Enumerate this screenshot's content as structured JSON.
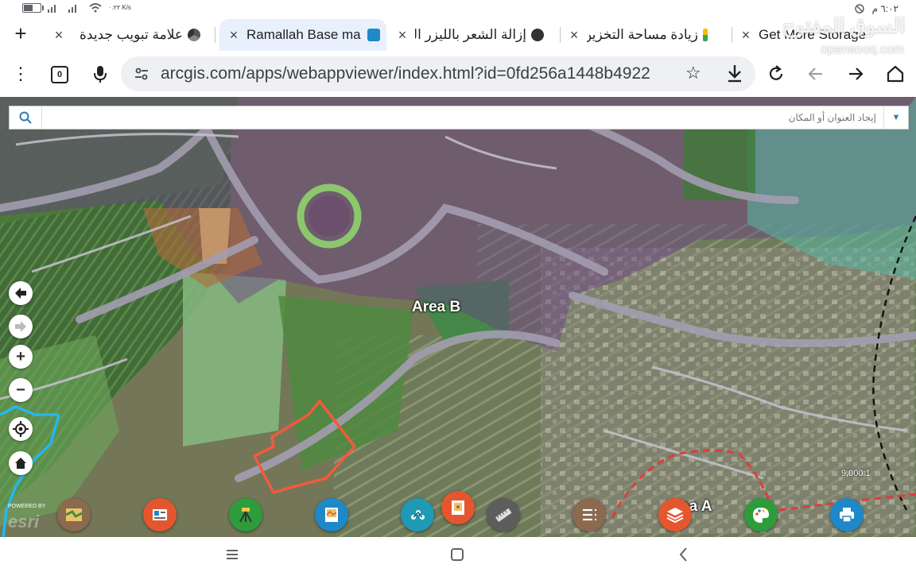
{
  "status_bar": {
    "time": "٦:٠٢ م",
    "net_speed": "٠.٢٢ K/s",
    "battery_level": 0.6
  },
  "tabs": [
    {
      "title": "علامة تبويب جديدة",
      "favicon": "chrome-icon",
      "active": false
    },
    {
      "title": "Ramallah Base ma",
      "favicon": "arcgis-icon",
      "active": true
    },
    {
      "title": "إزالة الشعر بالليزر الدو",
      "favicon": "globe-icon",
      "active": false
    },
    {
      "title": "زيادة مساحة التخزين",
      "favicon": "google-icon",
      "active": false
    },
    {
      "title": "Get More Storage",
      "favicon": "google-icon",
      "active": false
    }
  ],
  "toolbar": {
    "tab_count": "0",
    "url": "arcgis.com/apps/webappviewer/index.html?id=0fd256a1448b4922"
  },
  "map": {
    "search_placeholder": "إيجاد العنوان أو المكان",
    "labels": {
      "area_b": "Area B",
      "area_a": "ea A"
    },
    "scale_text": "9,000:1",
    "powered_by": "POWERED BY",
    "esri_logo": "esri",
    "widgets": [
      {
        "name": "basemap-gallery-widget",
        "color": "#8b6a4f"
      },
      {
        "name": "coordinate-widget",
        "color": "#e4572e"
      },
      {
        "name": "measurement-survey-widget",
        "color": "#2e9c3b"
      },
      {
        "name": "map-document-widget",
        "color": "#1e88c8"
      },
      {
        "name": "analysis-widget",
        "color": "#1e9ab4"
      },
      {
        "name": "photo-frame-widget",
        "color": "#e4572e"
      },
      {
        "name": "ruler-widget",
        "color": "#5d5d5d"
      },
      {
        "name": "list-widget",
        "color": "#8b6a4f"
      },
      {
        "name": "layers-widget",
        "color": "#e4572e"
      },
      {
        "name": "palette-widget",
        "color": "#2e9c3b"
      },
      {
        "name": "print-widget",
        "color": "#1e88c8"
      }
    ]
  },
  "watermark": {
    "arabic": "السوق المفتوح",
    "latin": "opensooq.com"
  }
}
